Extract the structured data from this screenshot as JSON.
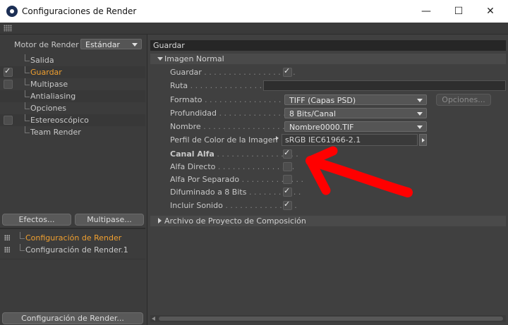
{
  "window": {
    "title": "Configuraciones de Render",
    "minimize": "—",
    "maximize": "☐",
    "close": "✕"
  },
  "left": {
    "motor_label": "Motor de Render",
    "motor_value": "Estándar",
    "tree": [
      {
        "label": "Salida",
        "checkbox": false,
        "checked": false,
        "active": false
      },
      {
        "label": "Guardar",
        "checkbox": true,
        "checked": true,
        "active": true
      },
      {
        "label": "Multipase",
        "checkbox": true,
        "checked": false,
        "active": false
      },
      {
        "label": "Antialiasing",
        "checkbox": false,
        "checked": false,
        "active": false
      },
      {
        "label": "Opciones",
        "checkbox": false,
        "checked": false,
        "active": false
      },
      {
        "label": "Estereoscópico",
        "checkbox": true,
        "checked": false,
        "active": false
      },
      {
        "label": "Team Render",
        "checkbox": false,
        "checked": false,
        "active": false
      }
    ],
    "efectos_button": "Efectos...",
    "multipase_button": "Multipase...",
    "configs": [
      {
        "label": "Configuración de Render",
        "active": true
      },
      {
        "label": "Configuración de Render.1",
        "active": false
      }
    ],
    "bottom_button": "Configuración de Render..."
  },
  "right": {
    "header": "Guardar",
    "section1": "Imagen Normal",
    "guardar_label": "Guardar",
    "guardar_dots": " . . . . . . . . . . . . . . . . . . .",
    "ruta_label": "Ruta",
    "ruta_dots": " . . . . . . . . . . . . . . . . . . . . . .",
    "formato_label": "Formato",
    "formato_dots": " . . . . . . . . . . . . . . . . . . .",
    "formato_value": "TIFF (Capas PSD)",
    "opciones_button": "Opciones...",
    "profundidad_label": "Profundidad",
    "profundidad_dots": " . . . . . . . . . . . . . . . .",
    "profundidad_value": "8 Bits/Canal",
    "nombre_label": "Nombre",
    "nombre_dots": " . . . . . . . . . . . . . . . . . . .",
    "nombre_value": "Nombre0000.TIF",
    "perfil_label": "Perfil de Color de la Imagen",
    "perfil_value": "sRGB IEC61966-2.1",
    "canal_alfa_label": "Canal Alfa",
    "canal_alfa_dots": " . . . . . . . . . . . . . . . . .",
    "alfa_directo_label": "Alfa Directo",
    "alfa_directo_dots": " . . . . . . . . . . . . . . . .",
    "alfa_separado_label": "Alfa Por Separado",
    "alfa_separado_dots": " . . . . . . . . . . . . .",
    "difuminado_label": "Difuminado a 8 Bits",
    "difuminado_dots": " . . . . . . . . . . .",
    "sonido_label": "Incluir Sonido",
    "sonido_dots": " . . . . . . . . . . . . . . .",
    "section2": "Archivo de Proyecto de Composición",
    "checkmark": "✓"
  },
  "colors": {
    "accent": "#f0a030",
    "annotation": "#ff0000"
  }
}
